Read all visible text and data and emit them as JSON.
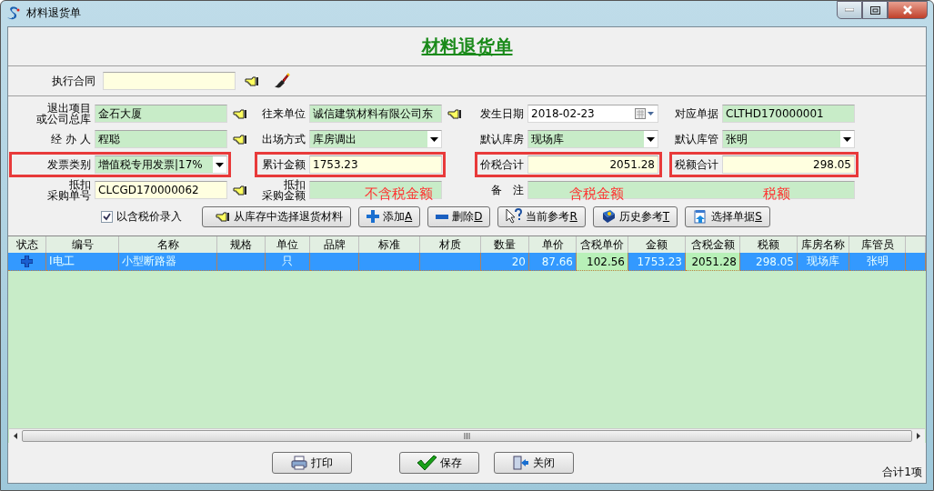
{
  "window": {
    "title": "材料退货单"
  },
  "heading": "材料退货单",
  "contract": {
    "label": "执行合同",
    "readonly": false
  },
  "form": {
    "rows": [
      {
        "fields": [
          {
            "label_lines": [
              "退出项目",
              "或公司总库"
            ],
            "kind": "text",
            "value": "金石大厦",
            "readonly": true,
            "lookup": true,
            "highlighted": false
          },
          {
            "label": "往来单位",
            "kind": "text",
            "value": "诚信建筑材料有限公司东",
            "readonly": true,
            "lookup": true,
            "highlighted": false
          },
          {
            "label": "发生日期",
            "kind": "date",
            "value": "2018-02-23",
            "readonly": false,
            "lookup": false,
            "highlighted": false
          },
          {
            "label": "对应单据",
            "kind": "text",
            "value": "CLTHD170000001",
            "readonly": true,
            "lookup": false,
            "highlighted": false
          }
        ]
      },
      {
        "fields": [
          {
            "label": "经 办 人",
            "kind": "text",
            "value": "程聪",
            "readonly": true,
            "lookup": true,
            "highlighted": false
          },
          {
            "label": "出场方式",
            "kind": "combo",
            "value": "库房调出",
            "readonly": true,
            "lookup": false,
            "highlighted": false
          },
          {
            "label": "默认库房",
            "kind": "combo",
            "value": "现场库",
            "readonly": true,
            "lookup": false,
            "highlighted": false
          },
          {
            "label": "默认库管",
            "kind": "combo",
            "value": "张明",
            "readonly": true,
            "lookup": false,
            "highlighted": false
          }
        ]
      },
      {
        "fields": [
          {
            "label": "发票类别",
            "kind": "combo",
            "value": "增值税专用发票|17%",
            "readonly": true,
            "lookup": false,
            "highlighted": true
          },
          {
            "label": "累计金额",
            "kind": "text",
            "value": "1753.23",
            "readonly": false,
            "lookup": false,
            "highlighted": true
          },
          {
            "label": "价税合计",
            "kind": "number",
            "value": "2051.28",
            "readonly": false,
            "lookup": false,
            "highlighted": true
          },
          {
            "label": "税额合计",
            "kind": "number",
            "value": "298.05",
            "readonly": false,
            "lookup": false,
            "highlighted": true
          }
        ]
      },
      {
        "fields": [
          {
            "label_lines": [
              "抵扣",
              "采购单号"
            ],
            "kind": "text",
            "value": "CLCGD170000062",
            "readonly": false,
            "lookup": true,
            "highlighted": false
          },
          {
            "label_lines": [
              "抵扣",
              "采购金额"
            ],
            "kind": "text",
            "readonly": true,
            "lookup": false,
            "highlighted": false,
            "notes": [
              "不含税金额"
            ]
          },
          {
            "label": "备　注",
            "kind": "text",
            "readonly": true,
            "lookup": false,
            "highlighted": false,
            "notes": [
              "含税金额",
              "税额"
            ]
          }
        ]
      }
    ]
  },
  "toolbar": {
    "checkbox": {
      "label": "以含税价录入",
      "checked": true
    },
    "buttons": [
      {
        "label": "从库存中选择退货材料"
      },
      {
        "label": "添加",
        "key": "A"
      },
      {
        "label": "删除",
        "key": "D"
      },
      {
        "label": "当前参考",
        "key": "R"
      },
      {
        "label": "历史参考",
        "key": "T"
      },
      {
        "label": "选择单据",
        "key": "S"
      }
    ]
  },
  "table": {
    "columns": [
      {
        "title": "状态",
        "kind": "icon",
        "editable": false
      },
      {
        "title": "编号",
        "kind": "text",
        "editable": false
      },
      {
        "title": "名称",
        "kind": "text",
        "editable": false
      },
      {
        "title": "规格",
        "kind": "text",
        "editable": false
      },
      {
        "title": "单位",
        "kind": "center",
        "editable": false
      },
      {
        "title": "品牌",
        "kind": "text",
        "editable": false
      },
      {
        "title": "标准",
        "kind": "text",
        "editable": false
      },
      {
        "title": "材质",
        "kind": "text",
        "editable": false
      },
      {
        "title": "数量",
        "kind": "number",
        "editable": false
      },
      {
        "title": "单价",
        "kind": "number",
        "editable": false
      },
      {
        "title": "含税单价",
        "kind": "number",
        "editable": true
      },
      {
        "title": "金额",
        "kind": "number",
        "editable": false
      },
      {
        "title": "含税金额",
        "kind": "number",
        "editable": true
      },
      {
        "title": "税额",
        "kind": "number",
        "editable": false
      },
      {
        "title": "库房名称",
        "kind": "center",
        "editable": false
      },
      {
        "title": "库管员",
        "kind": "center",
        "editable": false
      }
    ],
    "rows": [
      {
        "selected": true,
        "added": true,
        "cells": [
          null,
          "I电工",
          "小型断路器",
          null,
          "只",
          null,
          null,
          null,
          "20",
          "87.66",
          "102.56",
          "1753.23",
          "2051.28",
          "298.05",
          "现场库",
          "张明"
        ]
      }
    ]
  },
  "footer": {
    "buttons": [
      "打印",
      "保存",
      "关闭"
    ],
    "count": "合计1项"
  }
}
